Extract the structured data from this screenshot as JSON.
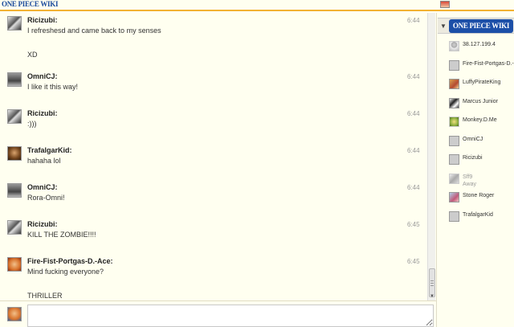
{
  "header": {
    "logo_text": "ONE PIECE WIKI"
  },
  "messages": [
    {
      "user": "Ricizubi:",
      "time": "6:44",
      "avatar": "ricizubi",
      "lines": [
        "I refreshesd and came back to my senses",
        "",
        "XD"
      ]
    },
    {
      "user": "OmniCJ:",
      "time": "6:44",
      "avatar": "omni",
      "lines": [
        "I like it this way!"
      ]
    },
    {
      "user": "Ricizubi:",
      "time": "6:44",
      "avatar": "ricizubi",
      "lines": [
        ":)))"
      ]
    },
    {
      "user": "TrafalgarKid:",
      "time": "6:44",
      "avatar": "trafalgar",
      "lines": [
        "hahaha lol"
      ]
    },
    {
      "user": "OmniCJ:",
      "time": "6:44",
      "avatar": "omni",
      "lines": [
        "Rora-Omni!"
      ]
    },
    {
      "user": "Ricizubi:",
      "time": "6:45",
      "avatar": "ricizubi",
      "lines": [
        "KILL THE ZOMBIE!!!!"
      ]
    },
    {
      "user": "Fire-Fist-Portgas-D.-Ace:",
      "time": "6:45",
      "avatar": "fire",
      "lines": [
        "Mind fucking everyone?",
        "",
        "THRILLER"
      ]
    }
  ],
  "sidebar": {
    "logo_text": "ONE PIECE WIKI",
    "users": [
      {
        "name": "38.127.199.4",
        "avatar": "anon",
        "status": ""
      },
      {
        "name": "Fire-Fist-Portgas-D.-",
        "avatar": "fire",
        "status": ""
      },
      {
        "name": "LuffyPirateKing",
        "avatar": "luffy",
        "status": ""
      },
      {
        "name": "Marcus Junior",
        "avatar": "marcus",
        "status": ""
      },
      {
        "name": "Monkey.D.Me",
        "avatar": "monkey",
        "status": ""
      },
      {
        "name": "OmniCJ",
        "avatar": "omni",
        "status": ""
      },
      {
        "name": "Ricizubi",
        "avatar": "ricizubi",
        "status": ""
      },
      {
        "name": "Sff9",
        "avatar": "sff",
        "status": "Away"
      },
      {
        "name": "Stone Roger",
        "avatar": "stone",
        "status": ""
      },
      {
        "name": "TrafalgarKid",
        "avatar": "trafalgar",
        "status": ""
      }
    ]
  },
  "input": {
    "value": "",
    "placeholder": ""
  },
  "colors": {
    "accent": "#f2b233",
    "logo_blue": "#1c4fa8",
    "background": "#fffff0"
  }
}
